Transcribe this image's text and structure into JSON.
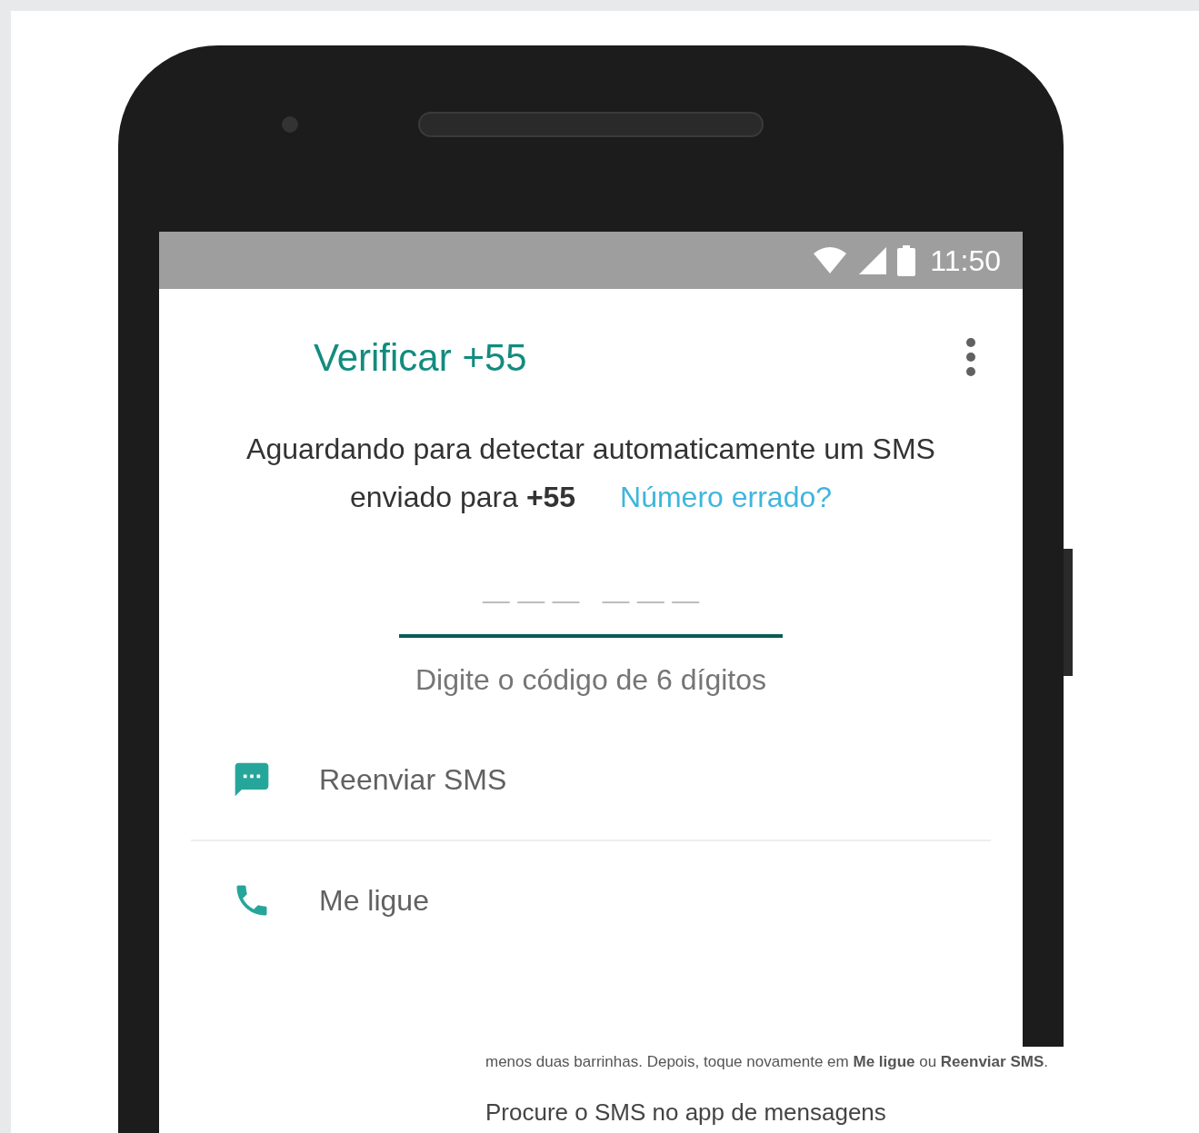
{
  "status_bar": {
    "time": "11:50"
  },
  "app_bar": {
    "title": "Verificar +55"
  },
  "message": {
    "text": "Aguardando para detectar automaticamente um SMS enviado para **+55**",
    "link": "Número errado?"
  },
  "code_field": {
    "placeholder": "— — —   — — —",
    "hint": "Digite o código de 6 dígitos"
  },
  "options": [
    {
      "kind": "sms",
      "label": "Reenviar SMS"
    },
    {
      "kind": "call",
      "label": "Me ligue"
    }
  ],
  "article": {
    "line": "menos duas barrinhas. Depois, toque novamente em **Me ligue** ou **Reenviar SMS**.",
    "heading": "Procure o SMS no app de mensagens"
  }
}
